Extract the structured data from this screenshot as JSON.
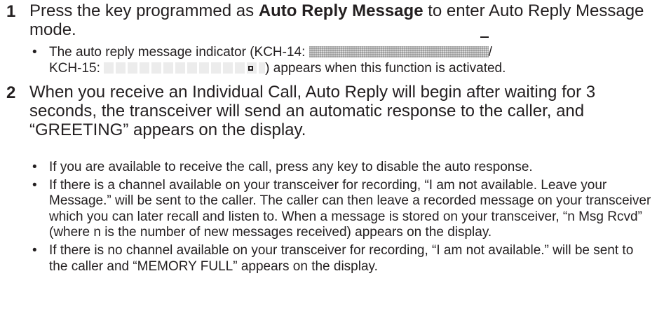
{
  "step1": {
    "number": "1",
    "text_before": "Press the key programmed as ",
    "bold": "Auto Reply Message",
    "text_after": " to enter Auto Reply Message mode.",
    "bullet": {
      "part1": "The auto reply message indicator (KCH-14: ",
      "slash": "/",
      "part2": "KCH-15: ",
      "part3": ") appears when this function is activated."
    }
  },
  "step2": {
    "number": "2",
    "text": "When you receive an Individual Call, Auto Reply will begin after waiting for 3 seconds, the transceiver will send an automatic response to the caller, and “GREETING” appears on the display.",
    "bullets": [
      "If you are available to receive the call, press any key to disable the auto response.",
      "If there is a channel available on your transceiver for recording, “I am not available. Leave your Message.” will be sent to the caller.  The caller can then leave a recorded message on your transceiver which you can later recall and listen to.  When a message is stored on your transceiver, “n Msg Rcvd” (where n is the number of new messages received) appears on the display.",
      "If there is no channel available on your transceiver for recording, “I am not available.” will be sent to the caller and “MEMORY FULL” appears on the display."
    ]
  }
}
